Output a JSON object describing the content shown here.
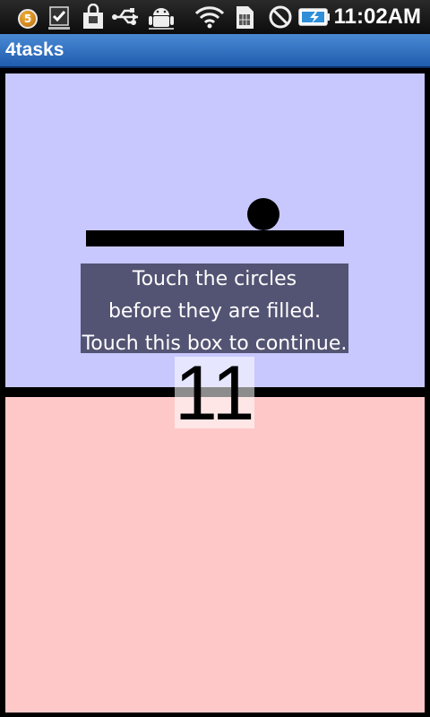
{
  "status_bar": {
    "notification_count": "5",
    "clock": "11:02AM",
    "icons": [
      "notification-badge-icon",
      "task-done-icon",
      "shopping-bag-icon",
      "usb-icon",
      "android-debug-icon",
      "wifi-icon",
      "sim-card-icon",
      "blocked-icon",
      "battery-charging-icon"
    ]
  },
  "app": {
    "title": "4tasks"
  },
  "game": {
    "colors": {
      "top_panel": "#c8c8ff",
      "bottom_panel": "#ffc8c8",
      "frame": "#000000"
    },
    "instructions": [
      "Touch the circles",
      "before they are filled.",
      "Touch this box to continue."
    ],
    "counter": "11"
  }
}
